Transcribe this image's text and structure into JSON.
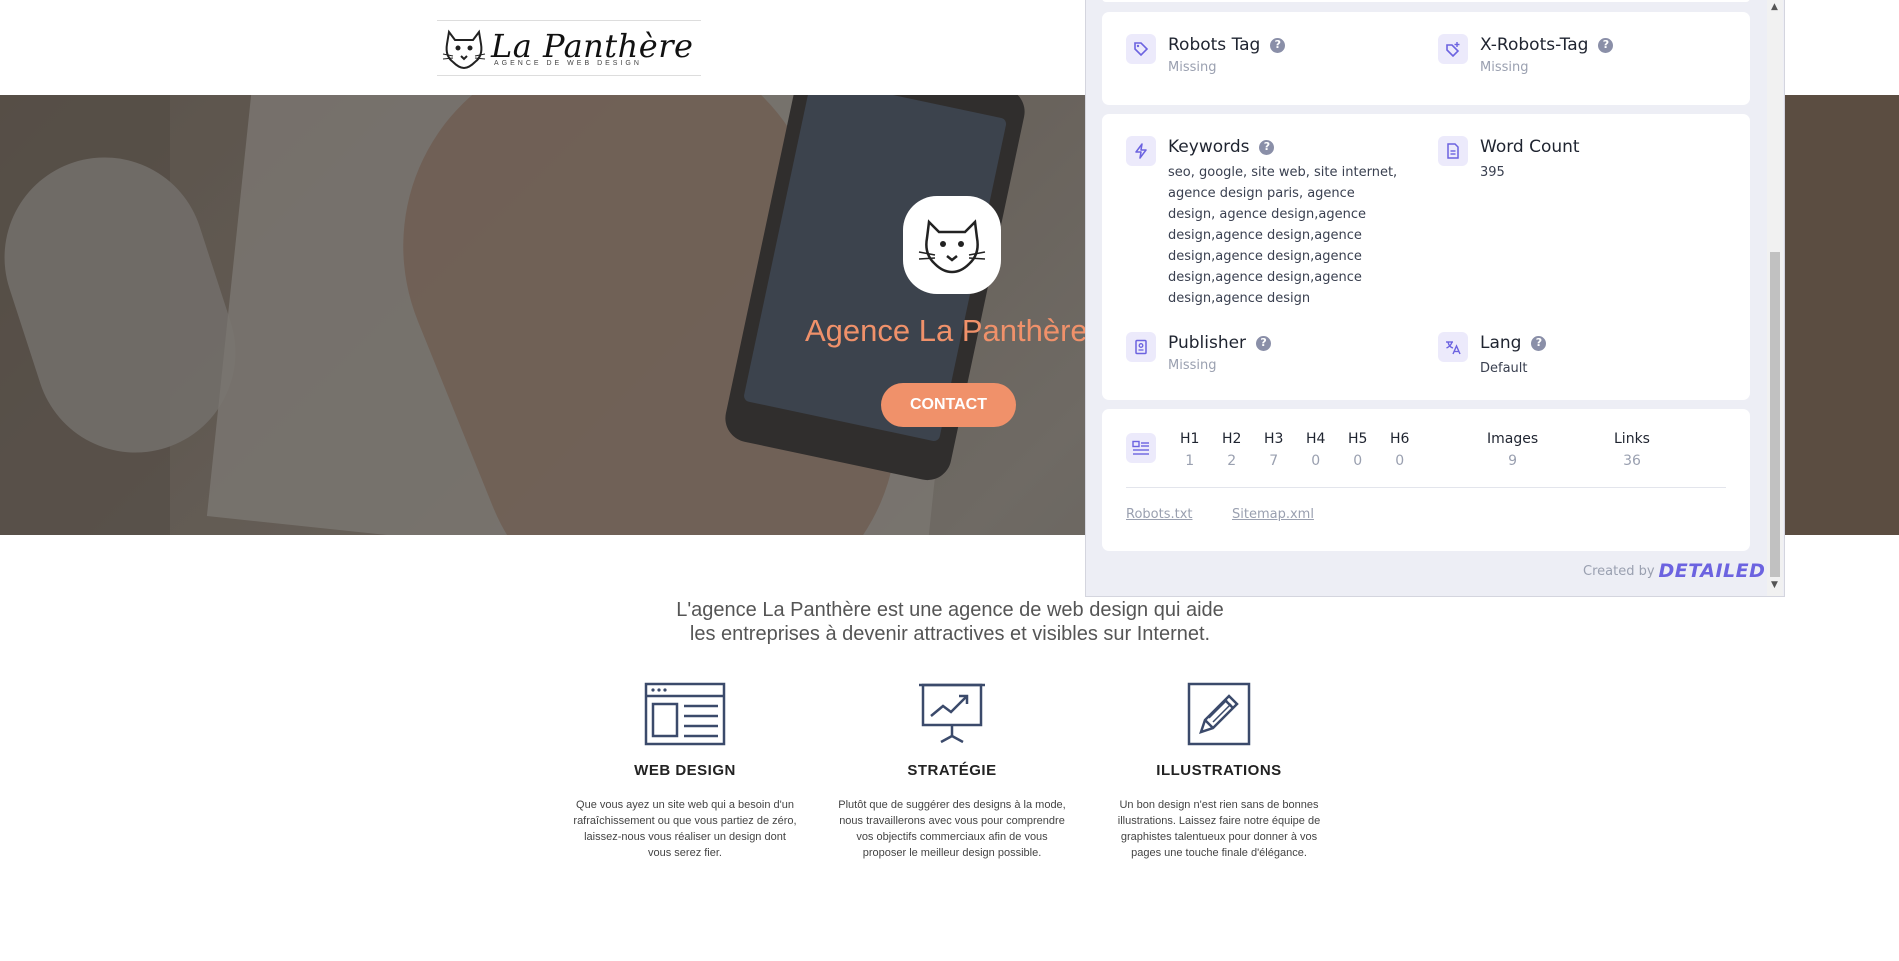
{
  "site": {
    "logo_name": "La Panthère",
    "logo_tagline": "AGENCE DE WEB DESIGN",
    "hero_title": "Agence La Panthère",
    "contact_label": "CONTACT",
    "intro_line1": "L'agence La Panthère est une agence de web design qui aide",
    "intro_line2": "les entreprises à devenir attractives et visibles sur Internet.",
    "services": [
      {
        "title": "WEB DESIGN",
        "icon": "browser-window-icon",
        "desc": "Que vous ayez un site web qui a besoin d'un rafraîchissement ou que vous partiez de zéro, laissez-nous vous réaliser un design dont vous serez fier."
      },
      {
        "title": "STRATÉGIE",
        "icon": "presentation-chart-icon",
        "desc": "Plutôt que de suggérer des designs à la mode, nous travaillerons avec vous pour comprendre vos objectifs commerciaux afin de vous proposer le meilleur design possible."
      },
      {
        "title": "ILLUSTRATIONS",
        "icon": "pencil-icon",
        "desc": "Un bon design n'est rien sans de bonnes illustrations. Laissez faire notre équipe de graphistes talentueux pour donner à vos pages une touche finale d'élégance."
      }
    ],
    "accent_color": "#f0916a"
  },
  "panel": {
    "robots_tag": {
      "label": "Robots Tag",
      "value": "Missing"
    },
    "x_robots_tag": {
      "label": "X-Robots-Tag",
      "value": "Missing"
    },
    "keywords": {
      "label": "Keywords",
      "value": "seo, google, site web, site internet, agence design paris, agence design, agence design,agence design,agence design,agence design,agence design,agence design,agence design,agence design,agence design"
    },
    "word_count": {
      "label": "Word Count",
      "value": "395"
    },
    "publisher": {
      "label": "Publisher",
      "value": "Missing"
    },
    "lang": {
      "label": "Lang",
      "value": "Default"
    },
    "help_glyph": "?",
    "headings": [
      {
        "label": "H1",
        "value": "1"
      },
      {
        "label": "H2",
        "value": "2"
      },
      {
        "label": "H3",
        "value": "7"
      },
      {
        "label": "H4",
        "value": "0"
      },
      {
        "label": "H5",
        "value": "0"
      },
      {
        "label": "H6",
        "value": "0"
      }
    ],
    "images": {
      "label": "Images",
      "value": "9"
    },
    "links": {
      "label": "Links",
      "value": "36"
    },
    "robots_link": "Robots.txt",
    "sitemap_link": "Sitemap.xml",
    "credit_prefix": "Created by",
    "credit_brand": "DETAILED",
    "brand_color": "#6c63e0"
  }
}
